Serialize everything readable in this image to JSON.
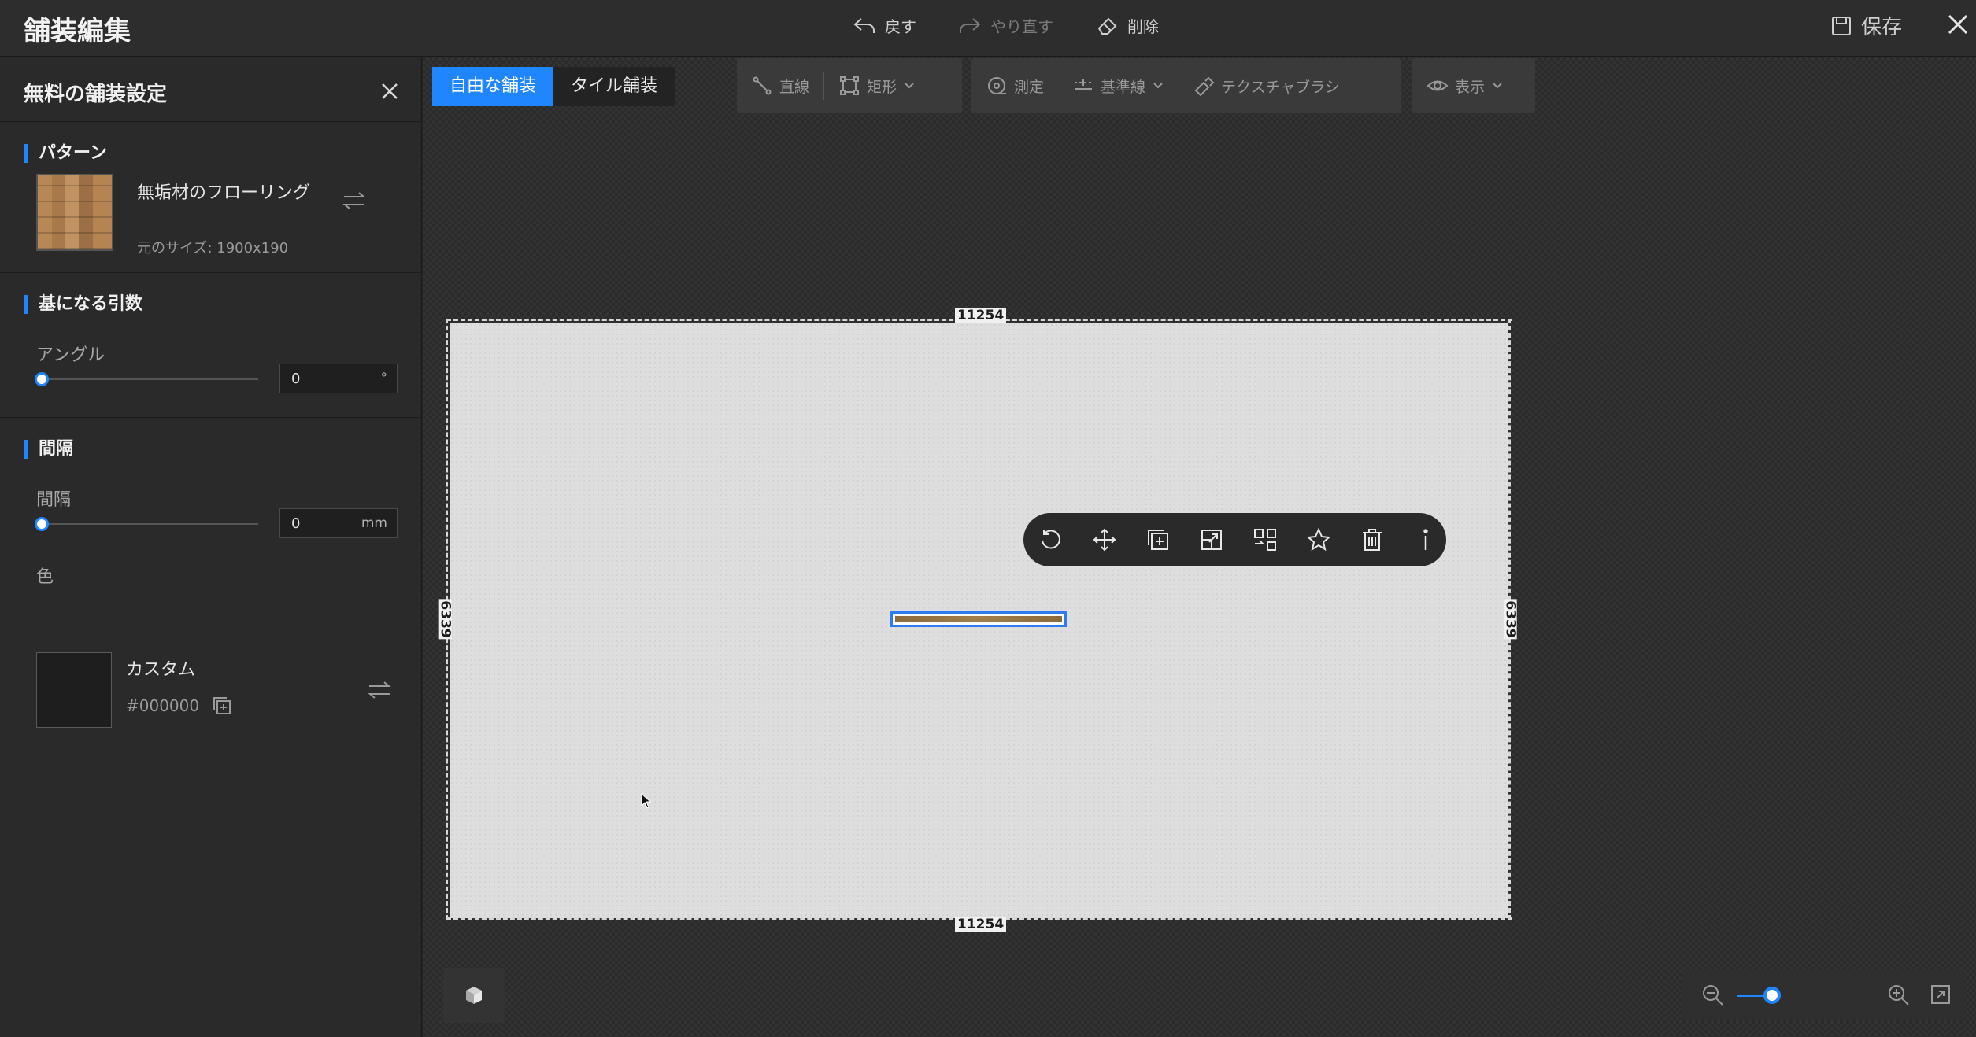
{
  "app": {
    "title": "舗装編集",
    "save_label": "保存"
  },
  "top_actions": {
    "undo": "戻す",
    "redo": "やり直す",
    "delete": "削除"
  },
  "panel": {
    "title": "無料の舗装設定",
    "pattern": {
      "section_title": "パターン",
      "name": "無垢材のフローリング",
      "size_text": "元のサイズ: 1900x190"
    },
    "base_params": {
      "section_title": "基になる引数",
      "angle_label": "アングル",
      "angle_value": "0",
      "angle_unit": "°",
      "angle_slider": 0
    },
    "gap": {
      "section_title": "間隔",
      "gap_label": "間隔",
      "gap_value": "0",
      "gap_unit": "mm",
      "gap_slider": 0,
      "color_label": "色",
      "color_name": "カスタム",
      "color_hex": "#000000"
    }
  },
  "mode_tabs": [
    {
      "label": "自由な舗装",
      "active": true
    },
    {
      "label": "タイル舗装",
      "active": false
    }
  ],
  "tools": {
    "line": "直線",
    "rect": "矩形",
    "measure": "測定",
    "guide": "基準線",
    "texture_brush": "テクスチャブラシ",
    "view": "表示"
  },
  "dimensions": {
    "width": "11254",
    "height": "6339"
  },
  "colors": {
    "accent": "#1f86ff",
    "panel_bg": "#2a2a2a",
    "canvas_floor": "#dedede"
  },
  "zoom": {
    "level": 0.45
  }
}
